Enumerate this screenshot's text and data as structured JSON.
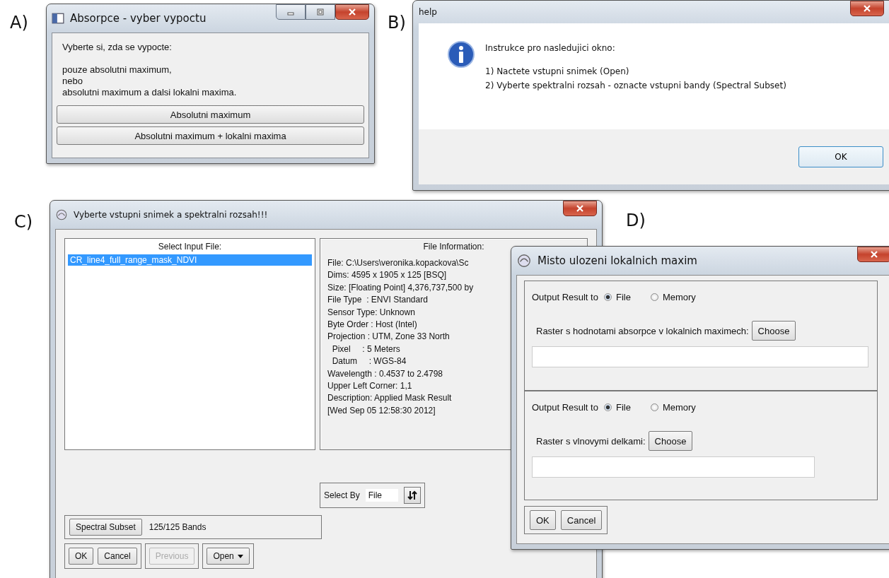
{
  "figure_labels": [
    "A)",
    "B)",
    "C)",
    "D)"
  ],
  "dialog_a": {
    "title": "Absorpce - vyber vypoctu",
    "prompt": "Vyberte si, zda se vypocte:",
    "message_lines": [
      "pouze absolutni maximum,",
      "nebo",
      "absolutni maximum a dalsi lokalni maxima."
    ],
    "buttons": [
      "Absolutni maximum",
      "Absolutni maximum + lokalni maxima"
    ]
  },
  "dialog_b": {
    "title": "help",
    "heading": "Instrukce pro nasledujici okno:",
    "steps": [
      "1) Nactete vstupni snimek (Open)",
      "2) Vyberte spektralni rozsah - oznacte vstupni bandy (Spectral Subset)"
    ],
    "button": "OK"
  },
  "dialog_c": {
    "title": "Vyberte vstupni snimek a spektralni rozsah!!!",
    "input_file": {
      "heading": "Select Input File:",
      "items": [
        {
          "label": "CR_line4_full_range_mask_NDVI",
          "selected": true
        }
      ]
    },
    "file_info": {
      "heading": "File Information:",
      "lines": [
        "File: C:\\Users\\veronika.kopackova\\Sc",
        "Dims: 4595 x 1905 x 125 [BSQ]",
        "Size: [Floating Point] 4,376,737,500 by",
        "File Type  : ENVI Standard",
        "Sensor Type: Unknown",
        "Byte Order : Host (Intel)",
        "Projection : UTM, Zone 33 North",
        "  Pixel     : 5 Meters",
        "  Datum     : WGS-84",
        "Wavelength : 0.4537 to 2.4798",
        "Upper Left Corner: 1,1",
        "Description: Applied Mask Result",
        "[Wed Sep 05 12:58:30 2012]"
      ]
    },
    "select_by": {
      "label": "Select By",
      "value": "File"
    },
    "spectral_subset": {
      "button": "Spectral Subset",
      "value": "125/125 Bands"
    },
    "button_groups": [
      [
        {
          "label": "OK",
          "kind": "push",
          "disabled": false
        },
        {
          "label": "Cancel",
          "kind": "push",
          "disabled": false
        }
      ],
      [
        {
          "label": "Previous",
          "kind": "push",
          "disabled": true
        }
      ],
      [
        {
          "label": "Open",
          "kind": "dropdown",
          "disabled": false
        }
      ]
    ]
  },
  "dialog_d": {
    "title": "Misto ulozeni lokalnich maxim",
    "sections": [
      {
        "output_label": "Output Result to",
        "options": [
          {
            "label": "File",
            "selected": true
          },
          {
            "label": "Memory",
            "selected": false
          }
        ],
        "raster_label": "Raster s hodnotami absorpce v lokalnich maximech:",
        "choose": "Choose"
      },
      {
        "output_label": "Output Result to",
        "options": [
          {
            "label": "File",
            "selected": true
          },
          {
            "label": "Memory",
            "selected": false
          }
        ],
        "raster_label": "Raster s vlnovymi delkami:",
        "choose": "Choose"
      }
    ],
    "buttons": [
      "OK",
      "Cancel"
    ]
  }
}
